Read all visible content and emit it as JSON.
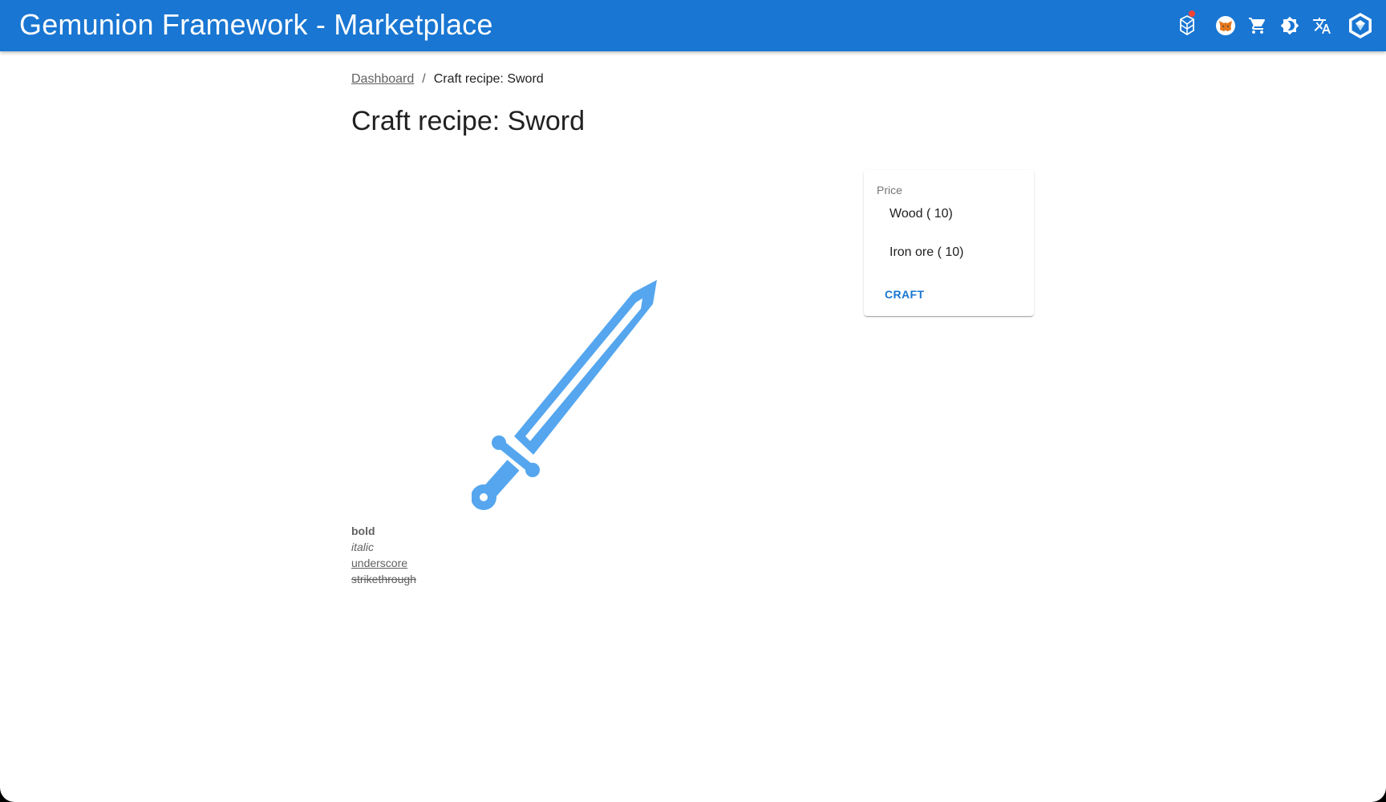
{
  "app": {
    "title": "Gemunion Framework - Marketplace"
  },
  "toolbar": {
    "icons": [
      "network-icon",
      "metamask-fox-icon",
      "cart-icon",
      "theme-toggle-icon",
      "translate-icon",
      "profile-badge-icon"
    ],
    "notification_dot_color": "#f44336"
  },
  "breadcrumb": {
    "dashboard_label": "Dashboard",
    "separator": "/",
    "current_label": "Craft recipe: Sword"
  },
  "page": {
    "title": "Craft recipe: Sword"
  },
  "item": {
    "image_icon": "sword-icon",
    "image_color": "#55a6ee"
  },
  "description": {
    "bold": "bold",
    "italic": "italic",
    "underscore": "underscore",
    "strikethrough": "strikethrough"
  },
  "price": {
    "label": "Price",
    "items": [
      {
        "label": "Wood ( 10)"
      },
      {
        "label": "Iron ore ( 10)"
      }
    ],
    "craft_label": "CRAFT"
  },
  "colors": {
    "appbar": "#1976d2",
    "accent": "#1976d2"
  }
}
